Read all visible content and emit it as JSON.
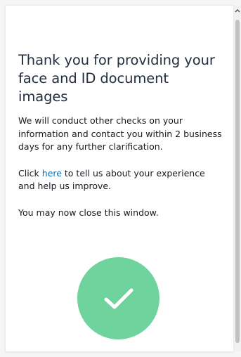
{
  "confirmation": {
    "title": "Thank you for providing your face and ID document images",
    "message": "We will conduct other checks on your information and contact you within 2 business days for any further clarification.",
    "feedback_prefix": "Click ",
    "feedback_link": "here",
    "feedback_suffix": " to tell us about your experience and help us improve.",
    "close_note": "You may now close this window."
  },
  "icons": {
    "status": "check-icon",
    "scroll_up": "chevron-up-icon"
  },
  "colors": {
    "success": "#6fd39d",
    "link": "#0073bb",
    "heading": "#232f3e"
  }
}
